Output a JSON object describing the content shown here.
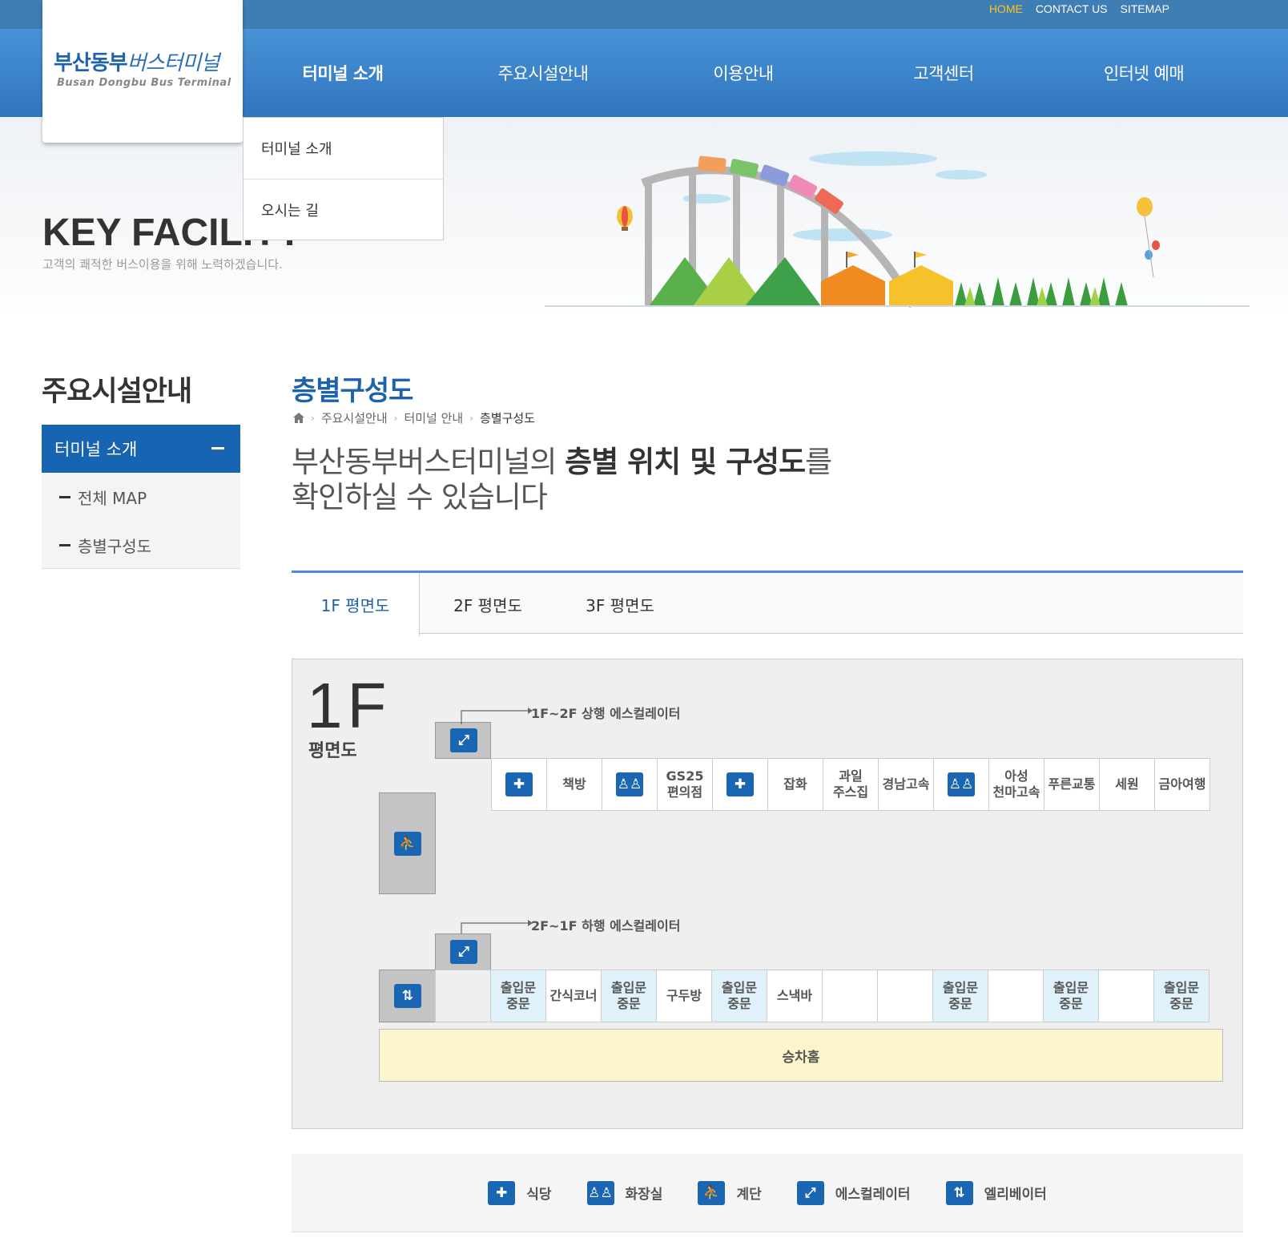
{
  "header": {
    "top_links": [
      "HOME",
      "CONTACT US",
      "SITEMAP"
    ],
    "logo_ko_bold": "부산동부",
    "logo_ko_rest": "버스터미널",
    "logo_en": "Busan Dongbu Bus Terminal",
    "menu": [
      "터미널 소개",
      "주요시설안내",
      "이용안내",
      "고객센터",
      "인터넷 예매"
    ],
    "dropdown": [
      "터미널 소개",
      "오시는 길"
    ]
  },
  "banner": {
    "title": "KEY FACILITY",
    "subtitle": "고객의 쾌적한 버스이용을 위해 노력하겠습니다."
  },
  "sidebar": {
    "title": "주요시설안내",
    "section": "터미널 소개",
    "items": [
      "전체 MAP",
      "층별구성도"
    ]
  },
  "main": {
    "title": "층별구성도",
    "breadcrumb": [
      "주요시설안내",
      "터미널 안내",
      "층별구성도"
    ],
    "intro_pre": "부산동부버스터미널의 ",
    "intro_bold": "층별 위치 및 구성도",
    "intro_post": "를",
    "intro_line2": "확인하실 수 있습니다",
    "tabs": [
      "1F 평면도",
      "2F 평면도",
      "3F 평면도"
    ],
    "active_tab": "1F 평면도"
  },
  "plan": {
    "floor": "1F",
    "floor_sub": "평면도",
    "esc_up": "1F~2F 상행 에스컬레이터",
    "esc_down": "2F~1F 하행 에스컬레이터",
    "upper_row": [
      "식당-icon",
      "책방",
      "화장실-icon",
      "GS25\n편의점",
      "식당-icon",
      "잡화",
      "과일\n주스집",
      "경남고속",
      "화장실-icon",
      "아성\n천마고속",
      "푸른교통",
      "세원",
      "금아여행"
    ],
    "lower_row": [
      "출입문\n중문",
      "간식코너",
      "출입문\n중문",
      "구두방",
      "출입문\n중문",
      "스낵바",
      "",
      "",
      "출입문\n중문",
      "",
      "출입문\n중문",
      "",
      "출입문\n중문"
    ],
    "hall": "승차홈"
  },
  "legend": [
    {
      "icon": "restaurant-icon",
      "label": "식당"
    },
    {
      "icon": "restroom-icon",
      "label": "화장실"
    },
    {
      "icon": "stairs-icon",
      "label": "계단"
    },
    {
      "icon": "escalator-icon",
      "label": "에스컬레이터"
    },
    {
      "icon": "elevator-icon",
      "label": "엘리베이터"
    }
  ],
  "colors": {
    "brand_blue": "#1764b1",
    "nav_blue": "#3f7db5",
    "home_link": "#ffc31a",
    "door_cell": "#dff2fb",
    "hall": "#fbf4cd"
  }
}
